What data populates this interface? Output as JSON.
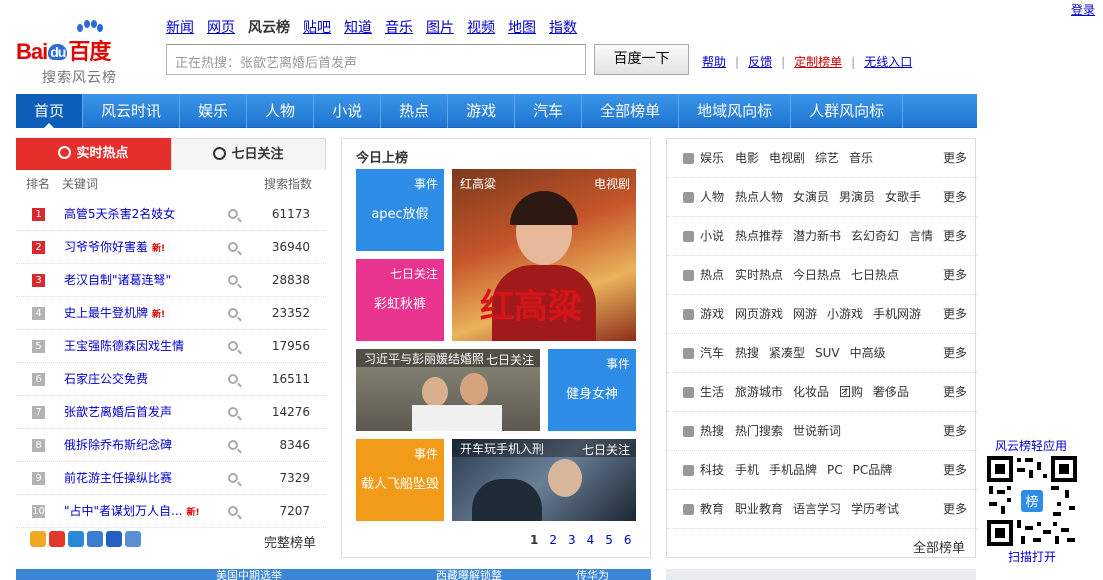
{
  "header": {
    "login": "登录",
    "logo": {
      "brand_bai": "Bai",
      "brand_du": "du",
      "brand_cn": "百度",
      "subtitle": "搜索风云榜"
    },
    "topnav": [
      {
        "label": "新闻",
        "current": false
      },
      {
        "label": "网页",
        "current": false
      },
      {
        "label": "风云榜",
        "current": true
      },
      {
        "label": "贴吧",
        "current": false
      },
      {
        "label": "知道",
        "current": false
      },
      {
        "label": "音乐",
        "current": false
      },
      {
        "label": "图片",
        "current": false
      },
      {
        "label": "视频",
        "current": false
      },
      {
        "label": "地图",
        "current": false
      },
      {
        "label": "指数",
        "current": false
      }
    ],
    "search": {
      "placeholder": "正在热搜：张歆艺离婚后首发声",
      "button": "百度一下"
    },
    "links": [
      {
        "label": "帮助",
        "red": false
      },
      {
        "label": "反馈",
        "red": false
      },
      {
        "label": "定制榜单",
        "red": true
      },
      {
        "label": "无线入口",
        "red": false
      }
    ]
  },
  "mainnav": [
    "首页",
    "风云时讯",
    "娱乐",
    "人物",
    "小说",
    "热点",
    "游戏",
    "汽车",
    "全部榜单",
    "地域风向标",
    "人群风向标"
  ],
  "left": {
    "tabs": {
      "active": "实时热点",
      "inactive": "七日关注"
    },
    "columns": {
      "rank": "排名",
      "keyword": "关键词",
      "index": "搜索指数"
    },
    "rows": [
      {
        "rank": "1",
        "keyword": "高管5天杀害2名妓女",
        "new": "",
        "value": "61173",
        "hot": true
      },
      {
        "rank": "2",
        "keyword": "习爷爷你好害羞",
        "new": "新!",
        "value": "36940",
        "hot": true
      },
      {
        "rank": "3",
        "keyword": "老汉自制\"诸葛连弩\"",
        "new": "",
        "value": "28838",
        "hot": true
      },
      {
        "rank": "4",
        "keyword": "史上最牛登机牌",
        "new": "新!",
        "value": "23352",
        "hot": false
      },
      {
        "rank": "5",
        "keyword": "王宝强陈德森因戏生情",
        "new": "",
        "value": "17956",
        "hot": false
      },
      {
        "rank": "6",
        "keyword": "石家庄公交免费",
        "new": "",
        "value": "16511",
        "hot": false
      },
      {
        "rank": "7",
        "keyword": "张歆艺离婚后首发声",
        "new": "",
        "value": "14276",
        "hot": false
      },
      {
        "rank": "8",
        "keyword": "俄拆除乔布斯纪念碑",
        "new": "",
        "value": "8346",
        "hot": false
      },
      {
        "rank": "9",
        "keyword": "前花游主任操纵比赛",
        "new": "",
        "value": "7329",
        "hot": false
      },
      {
        "rank": "10",
        "keyword": "\"占中\"者谋划万人自...",
        "new": "新!",
        "value": "7207",
        "hot": false
      }
    ],
    "full_list": "完整榜单"
  },
  "center": {
    "title": "今日上榜",
    "tiles": [
      {
        "tag": "事件",
        "text": "apec放假"
      },
      {
        "tag": "电视剧",
        "text": "红高粱"
      },
      {
        "tag": "七日关注",
        "text": "彩虹秋裤"
      },
      {
        "tag": "七日关注",
        "text": "习近平与彭丽媛结婚照"
      },
      {
        "tag": "事件",
        "text": "健身女神"
      },
      {
        "tag": "事件",
        "text": "载人飞船坠毁"
      },
      {
        "tag": "七日关注",
        "text": "开车玩手机入刑"
      }
    ],
    "pages": [
      "1",
      "2",
      "3",
      "4",
      "5",
      "6"
    ]
  },
  "right": {
    "rows": [
      {
        "cat": "娱乐",
        "items": [
          "电影",
          "电视剧",
          "综艺",
          "音乐"
        ],
        "more": "更多"
      },
      {
        "cat": "人物",
        "items": [
          "热点人物",
          "女演员",
          "男演员",
          "女歌手"
        ],
        "more": "更多"
      },
      {
        "cat": "小说",
        "items": [
          "热点推荐",
          "潜力新书",
          "玄幻奇幻",
          "言情"
        ],
        "more": "更多"
      },
      {
        "cat": "热点",
        "items": [
          "实时热点",
          "今日热点",
          "七日热点"
        ],
        "more": "更多"
      },
      {
        "cat": "游戏",
        "items": [
          "网页游戏",
          "网游",
          "小游戏",
          "手机网游"
        ],
        "more": "更多"
      },
      {
        "cat": "汽车",
        "items": [
          "热搜",
          "紧凑型",
          "SUV",
          "中高级"
        ],
        "more": "更多"
      },
      {
        "cat": "生活",
        "items": [
          "旅游城市",
          "化妆品",
          "团购",
          "奢侈品"
        ],
        "more": "更多"
      },
      {
        "cat": "热搜",
        "items": [
          "热门搜索",
          "世说新词"
        ],
        "more": "更多"
      },
      {
        "cat": "科技",
        "items": [
          "手机",
          "手机品牌",
          "PC",
          "PC品牌"
        ],
        "more": "更多"
      },
      {
        "cat": "教育",
        "items": [
          "职业教育",
          "语言学习",
          "学历考试"
        ],
        "more": "更多"
      }
    ],
    "all": "全部榜单"
  },
  "qr": {
    "title": "风云榜轻应用",
    "scan": "扫描打开",
    "badge": "榜"
  },
  "bottom": {
    "left1": "美国中期选举",
    "left2": "西藏曝解锁整",
    "left3": "传华为"
  }
}
